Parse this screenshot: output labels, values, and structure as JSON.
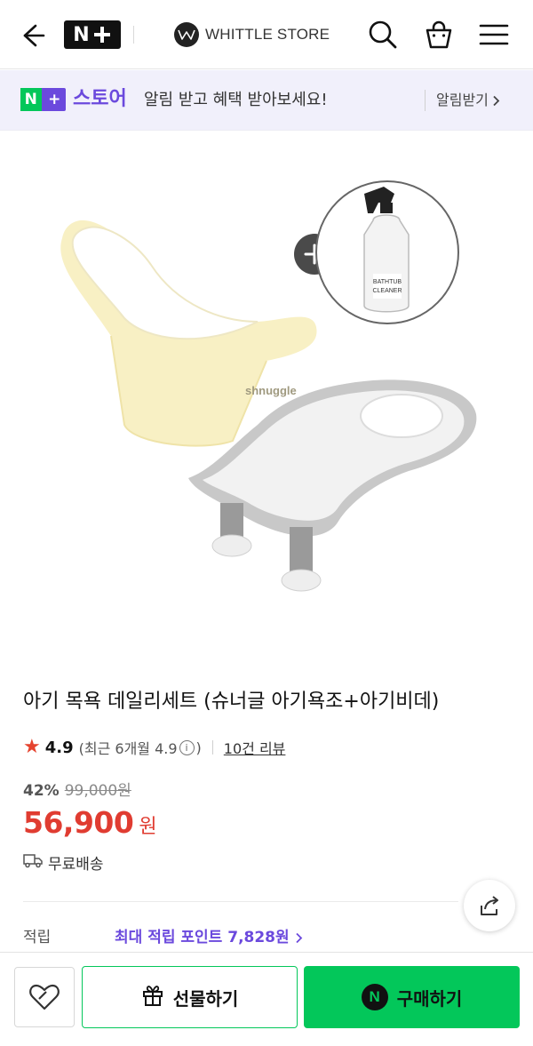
{
  "header": {
    "logo_n": "N",
    "store_name": "WHITTLE STORE",
    "store_badge": "W"
  },
  "notice": {
    "badge_n": "N",
    "badge_plus": "+",
    "store_word": "스토어",
    "message": "알림 받고 혜택 받아보세요!",
    "alarm_label": "알림받기"
  },
  "product": {
    "image_brand_text": "shnuggle",
    "cleaner_label_line1": "BATHTUB",
    "cleaner_label_line2": "CLEANER",
    "title": "아기 목욕 데일리세트 (슈너글 아기욕조+아기비데)",
    "rating": "4.9",
    "recent_rating_text": "(최근 6개월 4.9",
    "recent_rating_close": ")",
    "reviews_text": "10건 리뷰",
    "discount_pct": "42%",
    "original_price": "99,000원",
    "price": "56,900",
    "currency": "원",
    "shipping": "무료배송",
    "points_label": "적립",
    "points_value": "최대 적립 포인트 7,828원"
  },
  "bottom_bar": {
    "gift_label": "선물하기",
    "buy_label": "구매하기",
    "buy_badge": "N"
  },
  "colors": {
    "naver_green": "#03c75a",
    "store_purple": "#6b49dd",
    "price_red": "#e03c31"
  }
}
